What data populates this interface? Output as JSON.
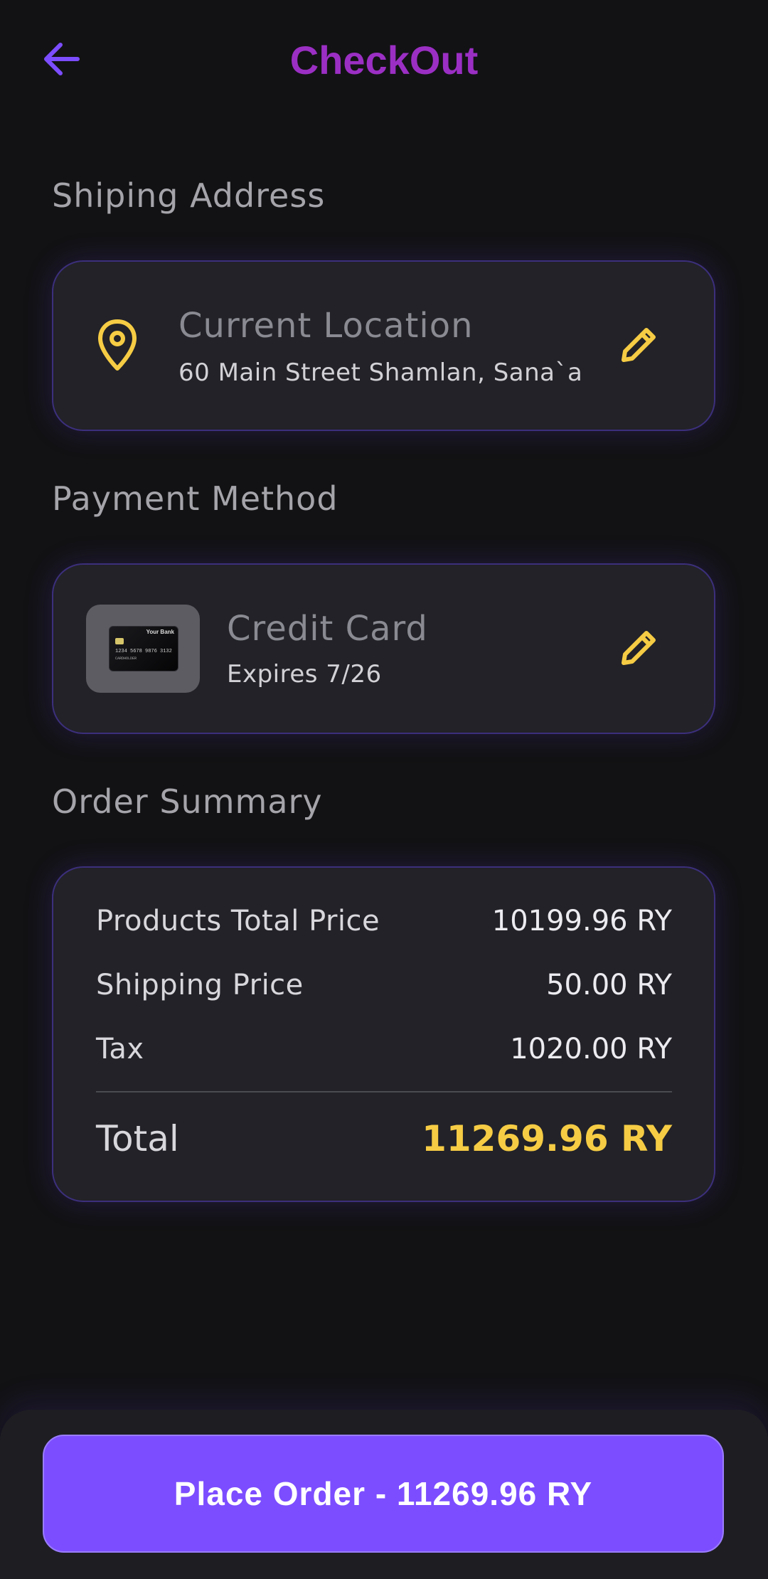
{
  "header": {
    "title": "CheckOut",
    "back_icon": "arrow-left-icon"
  },
  "colors": {
    "title": "#9b2fc4",
    "accent": "#7c4dff",
    "highlight": "#f6cc44",
    "card_border": "#3c2f7c",
    "background": "#121214"
  },
  "shipping": {
    "section_title": "Shiping Address",
    "title": "Current Location",
    "address": "60 Main Street Shamlan, Sana`a",
    "icon": "location-pin-icon",
    "edit_icon": "pencil-icon"
  },
  "payment": {
    "section_title": "Payment Method",
    "title": "Credit Card",
    "expiry": "Expires 7/26",
    "card_image": {
      "bank": "Your Bank",
      "number": "1234 5678 9876 3132",
      "holder": "CARDHOLDER"
    },
    "edit_icon": "pencil-icon"
  },
  "summary": {
    "section_title": "Order Summary",
    "rows": [
      {
        "label": "Products Total Price",
        "value": "10199.96 RY"
      },
      {
        "label": "Shipping Price",
        "value": "50.00 RY"
      },
      {
        "label": "Tax",
        "value": "1020.00 RY"
      }
    ],
    "total_label": "Total",
    "total_value": "11269.96 RY"
  },
  "place_order": {
    "label": "Place Order - 11269.96 RY"
  }
}
